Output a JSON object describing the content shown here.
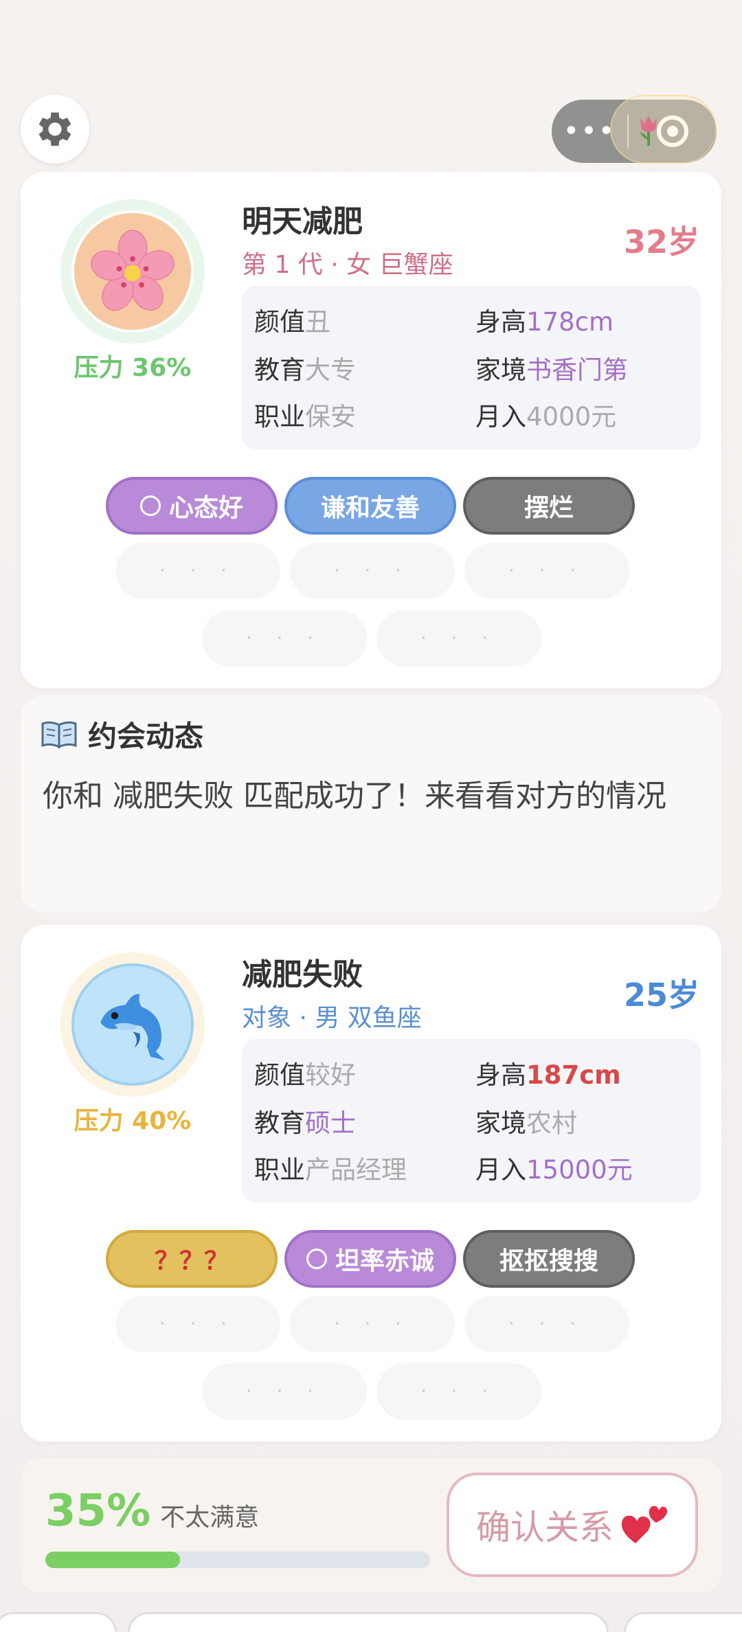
{
  "header": {
    "settings_icon": "gear-icon",
    "capsule_more": "•••",
    "capsule_icon": "target-icon"
  },
  "me": {
    "name": "明天减肥",
    "sub": "第 1 代 · 女 巨蟹座",
    "age": "32岁",
    "pressure": "压力 36%",
    "pressure_level": 0.36,
    "avatar_icon": "cherry-blossom-icon",
    "info": [
      {
        "label": "颜值",
        "value": "丑"
      },
      {
        "label": "身高",
        "value": "178cm"
      },
      {
        "label": "教育",
        "value": "大专"
      },
      {
        "label": "家境",
        "value": "书香门第"
      },
      {
        "label": "职业",
        "value": "保安"
      },
      {
        "label": "月入",
        "value": "4000元"
      }
    ],
    "tags": [
      {
        "label": "心态好"
      },
      {
        "label": "谦和友善"
      },
      {
        "label": "摆烂"
      }
    ],
    "empty_slots": [
      "· · ·",
      "· · ·",
      "· · ·",
      "· · ·",
      "· · ·"
    ]
  },
  "dynamics": {
    "icon": "book-icon",
    "title": "约会动态",
    "text": "你和 减肥失败 匹配成功了！来看看对方的情况"
  },
  "partner": {
    "name": "减肥失败",
    "sub": "对象 · 男 双鱼座",
    "age": "25岁",
    "pressure": "压力 40%",
    "pressure_level": 0.4,
    "avatar_icon": "dolphin-icon",
    "info": [
      {
        "label": "颜值",
        "value": "较好"
      },
      {
        "label": "身高",
        "value": "187cm"
      },
      {
        "label": "教育",
        "value": "硕士"
      },
      {
        "label": "家境",
        "value": "农村"
      },
      {
        "label": "职业",
        "value": "产品经理"
      },
      {
        "label": "月入",
        "value": "15000元"
      }
    ],
    "tags": [
      {
        "label": "？？？"
      },
      {
        "label": "坦率赤诚"
      },
      {
        "label": "抠抠搜搜"
      }
    ],
    "empty_slots": [
      "· · ·",
      "· · ·",
      "· · ·",
      "· · ·",
      "· · ·"
    ]
  },
  "satisfaction": {
    "percent": "35%",
    "label": "不太满意",
    "progress": 0.35,
    "confirm_label": "确认关系",
    "confirm_icon": "hearts-icon"
  },
  "colors": {
    "purple_tag": "#b98ad8",
    "blue_tag": "#79a6e4",
    "gray_tag": "#7d7d7d",
    "gold_tag": "#e3c15e",
    "red_value": "#d94848",
    "purple_value": "#a46fc7",
    "gray_value": "#aaaaaa",
    "pink_age": "#e37d8b",
    "blue_age": "#4d8ad6"
  }
}
